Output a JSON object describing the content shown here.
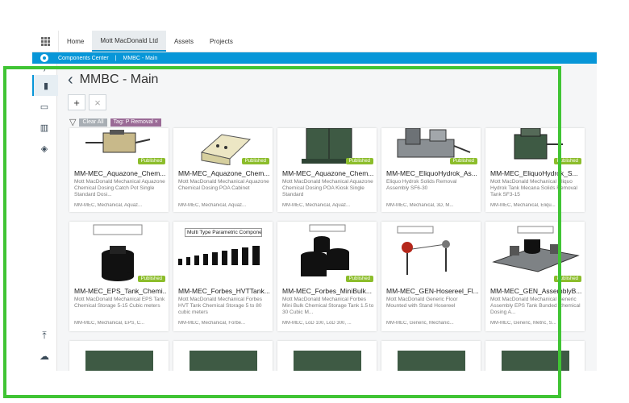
{
  "topnav": {
    "tabs": [
      {
        "label": "Home"
      },
      {
        "label": "Mott MacDonald Ltd"
      },
      {
        "label": "Assets"
      },
      {
        "label": "Projects"
      }
    ]
  },
  "breadcrumb": {
    "app": "Components Center",
    "separator": "|",
    "current": "MMBC - Main"
  },
  "page": {
    "title": "MMBC - Main"
  },
  "filters": {
    "clear": "Clear All",
    "tag": "Tag: P Removal",
    "tag_close": "×"
  },
  "badge": "Published",
  "cards": [
    {
      "title": "MM-MEC_Aquazone_Chem...",
      "desc": "Mott MacDonald Mechanical Aquazone Chemical Dosing Catch Pot Single Standard Dosi...",
      "tags": "MM-MEC, Mechanical, Aquaz..."
    },
    {
      "title": "MM-MEC_Aquazone_Chem...",
      "desc": "Mott MacDonald Mechanical Aquazone Chemical Dosing POA Cabinet",
      "tags": "MM-MEC, Mechanical, Aquaz..."
    },
    {
      "title": "MM-MEC_Aquazone_Chem...",
      "desc": "Mott MacDonald Mechanical Aquazone Chemical Dosing POA Kiosk Single Standard",
      "tags": "MM-MEC, Mechanical, Aquaz..."
    },
    {
      "title": "MM-MEC_EliquoHydrok_As...",
      "desc": "Eliquo Hydrok Solids Removal Assembly SF6-30",
      "tags": "MM-MEC, Mechanical, 3D, M..."
    },
    {
      "title": "MM-MEC_EliquoHydrok_S...",
      "desc": "Mott MacDonald Mechanical Eliquo Hydrok Tank Mecana Solids Removal Tank SF3-15",
      "tags": "MM-MEC, Mechanical, Eliqu..."
    },
    {
      "title": "MM-MEC_EPS_Tank_Chemi...",
      "desc": "Mott MacDonald Mechanical EPS Tank Chemical Storage 5-15 Cubic meters",
      "tags": "MM-MEC, Mechanical, EPS, C..."
    },
    {
      "title": "MM-MEC_Forbes_HVTTank...",
      "desc": "Mott MacDonald Mechanical Forbes HVT Tank Chemical Storage 5 to 80 cubic meters",
      "tags": "MM-MEC, Mechanical, Forbe..."
    },
    {
      "title": "MM-MEC_Forbes_MiniBulk...",
      "desc": "Mott MacDonald Mechanical Forbes Mini Bulk Chemical Storage Tank 1.5 to 30 Cubic M...",
      "tags": "MM-MEC, LoD 100, LoD 300, ..."
    },
    {
      "title": "MM-MEC_GEN-Hosereel_Fl...",
      "desc": "Mott MacDonald Generic Floor Mounted with Stand Hosereel",
      "tags": "MM-MEC, Generic, Mechanic..."
    },
    {
      "title": "MM-MEC_GEN_AssemblyB...",
      "desc": "Mott MacDonald Mechanical Generic Assembly EPS Tank Bunded Chemical Dosing A...",
      "tags": "MM-MEC, Generic, Metric, S..."
    }
  ],
  "thumb_labels": {
    "multi": "Multi Type Parametric Component"
  },
  "colors": {
    "accent": "#0796d8",
    "published": "#8cbd2b",
    "tag": "#9a6a96",
    "highlight": "#40c434"
  }
}
